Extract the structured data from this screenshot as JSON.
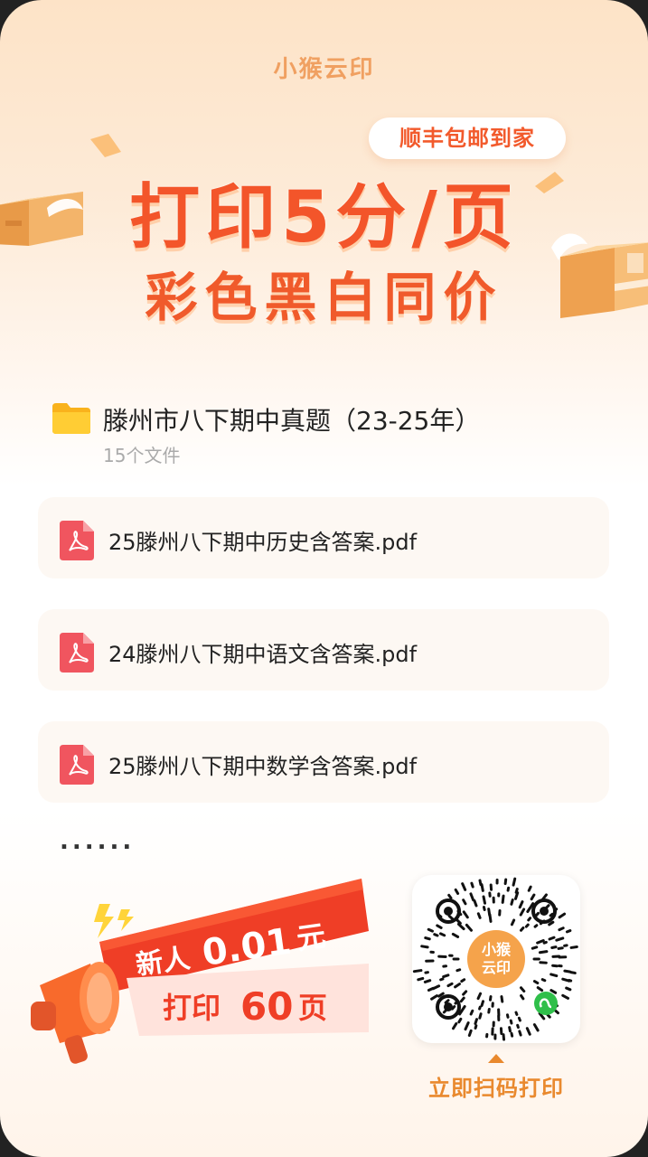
{
  "brand": "小猴云印",
  "banner": {
    "pill": "顺丰包邮到家",
    "headline1": "打印5分/页",
    "headline2": "彩色黑白同价"
  },
  "folder": {
    "title": "滕州市八下期中真题（23-25年）",
    "count": "15个文件"
  },
  "files": [
    {
      "name": "25滕州八下期中历史含答案.pdf"
    },
    {
      "name": "24滕州八下期中语文含答案.pdf"
    },
    {
      "name": "25滕州八下期中数学含答案.pdf"
    }
  ],
  "more": "......",
  "promo": {
    "line1_prefix": "新人",
    "line1_amount": "0.01",
    "line1_suffix": "元",
    "line2_prefix": "打印",
    "line2_amount": "60",
    "line2_suffix": "页"
  },
  "qr": {
    "center_text_1": "小猴",
    "center_text_2": "云印"
  },
  "scan_label": "立即扫码打印",
  "colors": {
    "accent_orange": "#f3552a",
    "label_orange": "#e9892e",
    "pdf_red": "#f0555f",
    "folder_yellow": "#ffc72a"
  }
}
